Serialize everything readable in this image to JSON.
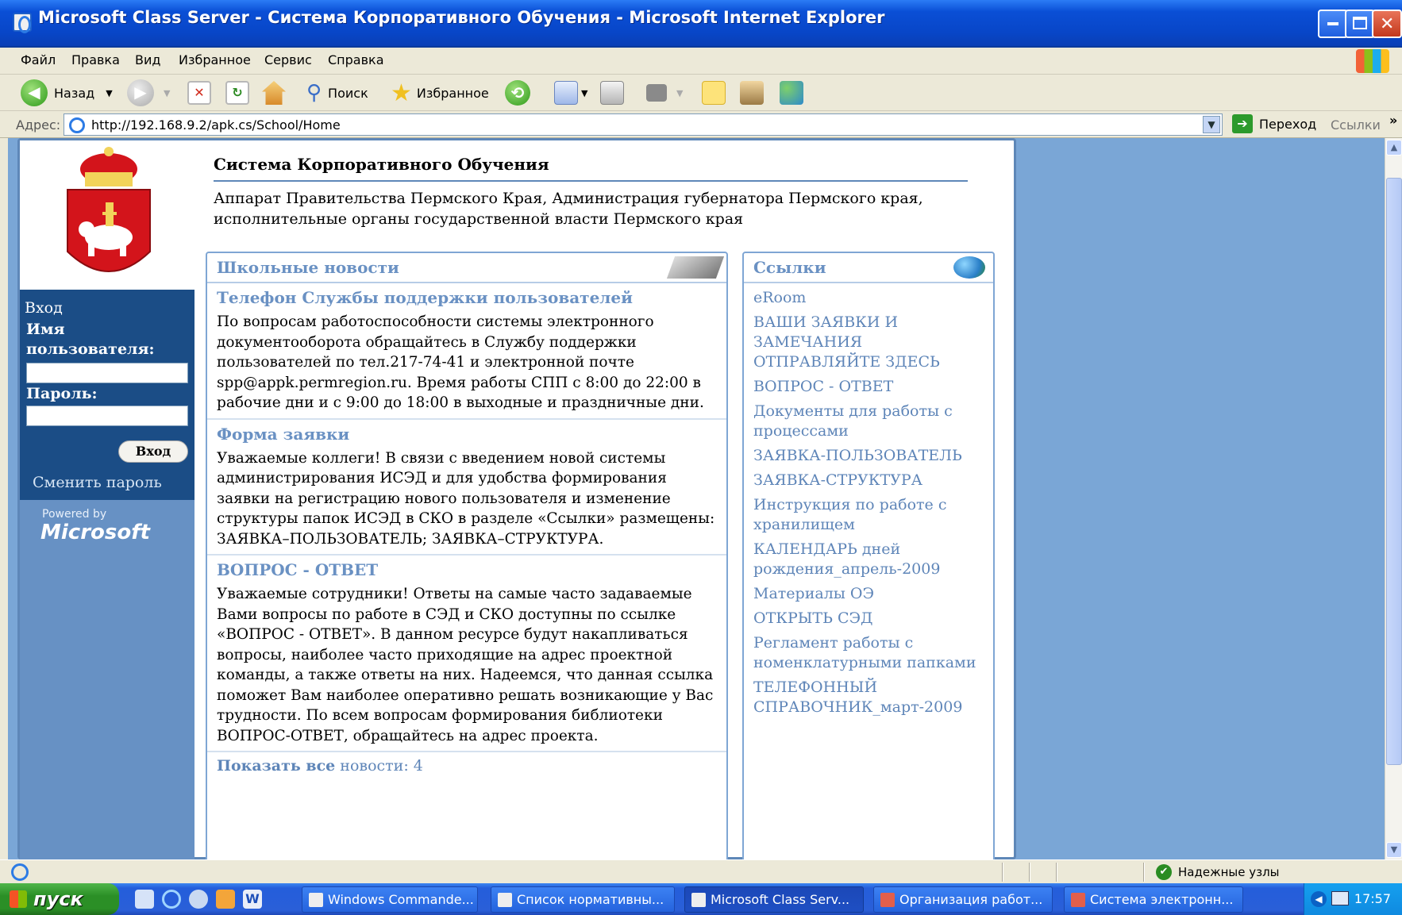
{
  "window": {
    "title": "Microsoft Class Server - Система Корпоративного Обучения - Microsoft Internet Explorer"
  },
  "menu": [
    "Файл",
    "Правка",
    "Вид",
    "Избранное",
    "Сервис",
    "Справка"
  ],
  "toolbar": {
    "back": "Назад",
    "search": "Поиск",
    "favorites": "Избранное"
  },
  "address": {
    "label": "Адрес:",
    "url": "http://192.168.9.2/apk.cs/School/Home",
    "go": "Переход",
    "links": "Ссылки"
  },
  "header": {
    "title": "Система Корпоративного Обучения",
    "subtitle": "Аппарат Правительства Пермского Края, Администрация губернатора Пермского края, исполнительные органы государственной власти Пермского края"
  },
  "login": {
    "heading": "Вход",
    "username_label": "Имя пользователя:",
    "password_label": "Пароль:",
    "button": "Вход",
    "change_password": "Сменить пароль",
    "powered_by": "Powered by",
    "brand": "Microsoft"
  },
  "news": {
    "title": "Школьные новости",
    "items": [
      {
        "title": "Телефон Службы поддержки пользователей",
        "body": "По вопросам работоспособности системы электронного документооборота обращайтесь в Службу поддержки пользователей по тел.217-74-41 и электронной почте spp@appk.permregion.ru. Время работы СПП с 8:00 до 22:00 в рабочие дни и с 9:00 до 18:00 в выходные и праздничные дни."
      },
      {
        "title": "Форма заявки",
        "body": "Уважаемые коллеги! В связи с введением новой системы администрирования ИСЭД и для удобства формирования заявки на регистрацию нового пользователя и изменение структуры папок ИСЭД в СКО в разделе «Ссылки» размещены: ЗАЯВКА–ПОЛЬЗОВАТЕЛЬ; ЗАЯВКА–СТРУКТУРА."
      },
      {
        "title": "ВОПРОС - ОТВЕТ",
        "body": "Уважаемые сотрудники! Ответы на самые часто задаваемые Вами вопросы по работе в СЭД и СКО доступны по ссылке «ВОПРОС - ОТВЕТ». В данном ресурсе будут накапливаться вопросы, наиболее часто приходящие на адрес проектной команды, а также ответы на них. Надеемся, что данная ссылка поможет Вам наиболее оперативно решать возникающие у Вас трудности. По всем вопросам формирования библиотеки ВОПРОС-ОТВЕТ, обращайтесь на адрес проекта."
      }
    ],
    "show_all": "Показать все",
    "count_text": "новости: 4"
  },
  "links": {
    "title": "Ссылки",
    "items": [
      "eRoom",
      "ВАШИ ЗАЯВКИ И ЗАМЕЧАНИЯ ОТПРАВЛЯЙТЕ ЗДЕСЬ",
      "ВОПРОС - ОТВЕТ",
      "Документы для работы с процессами",
      "ЗАЯВКА-ПОЛЬЗОВАТЕЛЬ",
      "ЗАЯВКА-СТРУКТУРА",
      "Инструкция по работе с хранилищем",
      "КАЛЕНДАРЬ дней рождения_апрель-2009",
      "Материалы ОЭ",
      "ОТКРЫТЬ СЭД",
      "Регламент работы с номенклатурными папками",
      "ТЕЛЕФОННЫЙ СПРАВОЧНИК_март-2009"
    ]
  },
  "status": {
    "zone": "Надежные узлы"
  },
  "taskbar": {
    "start": "пуск",
    "tasks": [
      "Windows Commande...",
      "Список нормативны...",
      "Microsoft Class Serv...",
      "Организация работ...",
      "Система электронн..."
    ],
    "clock": "17:57"
  },
  "colors": {
    "titlebar": "#0846c8",
    "page_bg": "#7aa6d6",
    "sidebar": "#1b4d86",
    "link": "#5e85b8",
    "crest_red": "#d3141b"
  }
}
